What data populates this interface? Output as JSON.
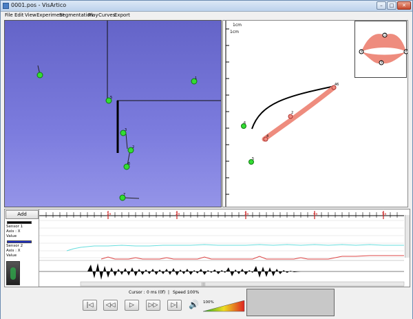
{
  "window": {
    "title": "0001.pos - VisArtico",
    "minimize": "–",
    "maximize": "□",
    "close": "✕"
  },
  "menu": [
    "File",
    "Edit",
    "View",
    "Experiment",
    "Segmentation",
    "Play",
    "Curves",
    "Export"
  ],
  "viewport_3d": {
    "sensor_labels": [
      "5",
      "1",
      "3",
      "2",
      "6",
      "7"
    ]
  },
  "midplane": {
    "scale_label_top": "1cm",
    "scale_label_left": "1cm",
    "point_labels": [
      "6",
      "5",
      "2",
      "4",
      "46"
    ]
  },
  "lips_labels": [
    "1",
    "2",
    "3",
    "4"
  ],
  "timeline": {
    "add_label": "Add",
    "time_ticks": [
      "1s",
      "2s",
      "3s",
      "4s",
      "5s"
    ],
    "y_ticks": [
      "97",
      "93",
      "89",
      "85",
      "81",
      "77"
    ],
    "sensor1": {
      "name": "Sensor 1",
      "axis": "Axis : X",
      "value": "Value",
      "color": "#000000"
    },
    "sensor2": {
      "name": "Sensor 2",
      "axis": "Axis : X",
      "value": "Value",
      "color": "#2233cc"
    },
    "scroll_grip": "|||"
  },
  "controls": {
    "cursor_text": "Cursor :",
    "cursor_value": "0 ms (0f)",
    "separator": "|",
    "speed_text": "Speed :",
    "speed_value": "100%",
    "volume": "100%",
    "buttons": [
      "|◁",
      "◁◁",
      "▷",
      "▷▷",
      "▷|"
    ],
    "speaker_icon": "🔊"
  },
  "colors": {
    "sensor_green": "#33dd33",
    "trace_salmon": "#ee8c7e",
    "cyan_curve": "#66dddd",
    "red_curve": "#dd4444",
    "viewport_blue": "#7070d8"
  }
}
